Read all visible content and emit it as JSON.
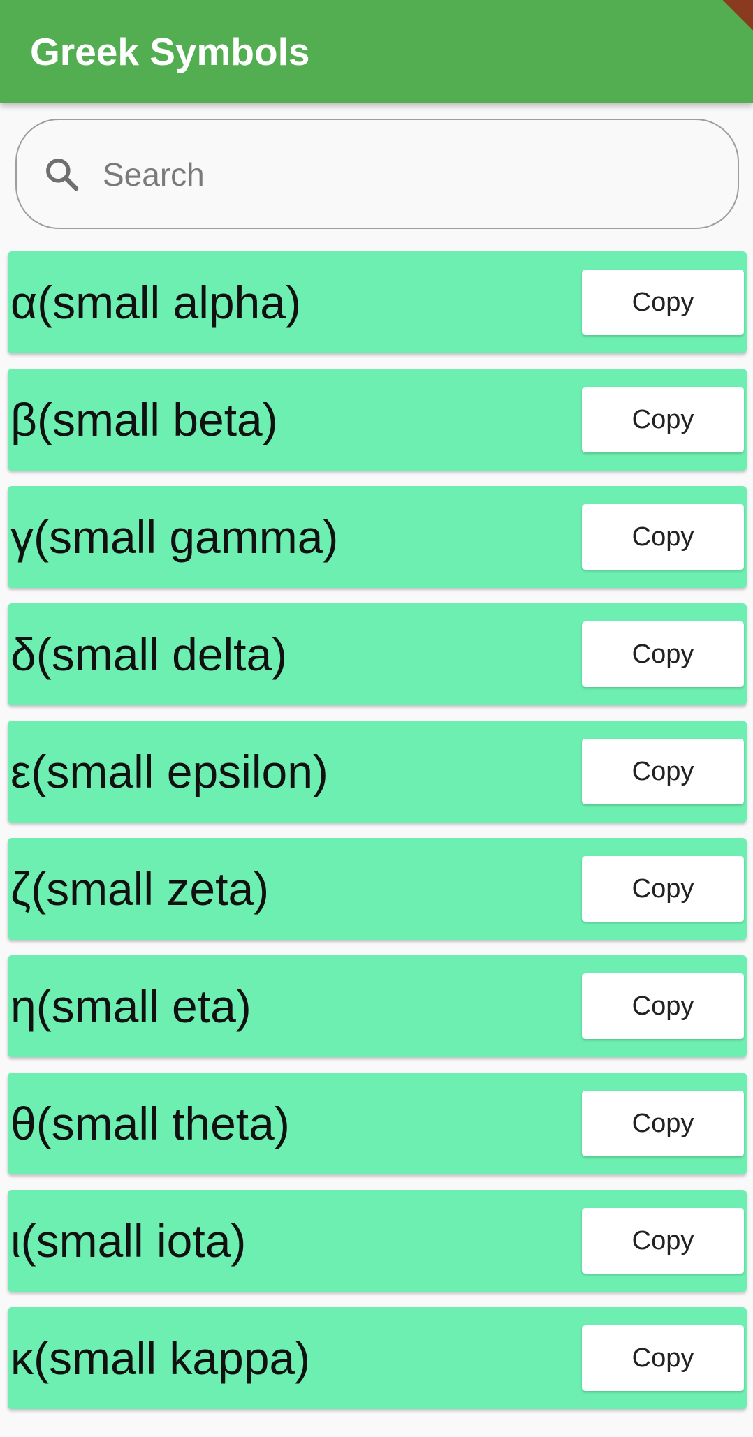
{
  "app_bar": {
    "title": "Greek Symbols",
    "color": "#52ae50"
  },
  "search": {
    "placeholder": "Search",
    "value": "",
    "icon": "search-icon"
  },
  "list": {
    "row_color": "#6cefb0",
    "items": [
      {
        "label": "α(small alpha)",
        "button": "Copy"
      },
      {
        "label": "β(small beta)",
        "button": "Copy"
      },
      {
        "label": "γ(small gamma)",
        "button": "Copy"
      },
      {
        "label": "δ(small delta)",
        "button": "Copy"
      },
      {
        "label": "ε(small epsilon)",
        "button": "Copy"
      },
      {
        "label": "ζ(small zeta)",
        "button": "Copy"
      },
      {
        "label": "η(small eta)",
        "button": "Copy"
      },
      {
        "label": "θ(small theta)",
        "button": "Copy"
      },
      {
        "label": "ι(small iota)",
        "button": "Copy"
      },
      {
        "label": "κ(small kappa)",
        "button": "Copy"
      }
    ]
  }
}
